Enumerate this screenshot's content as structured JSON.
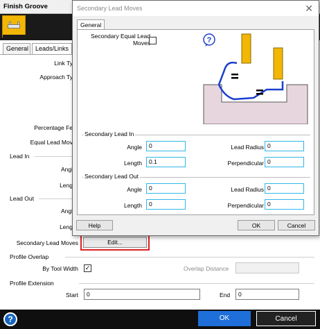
{
  "main": {
    "title": "Finish Groove",
    "tabs": [
      {
        "label": "General"
      },
      {
        "label": "Leads/Links"
      }
    ],
    "labels": {
      "link_type": "Link Ty",
      "approach_type": "Approach Ty",
      "percentage_feed": "Percentage Fe",
      "equal_lead_moves": "Equal Lead Mov",
      "lead_in_angle": "Angl",
      "lead_in_length": "Leng",
      "lead_out_angle": "Angl",
      "lead_out_length": "Leng",
      "secondary_lead_moves": "Secondary Lead Moves",
      "by_tool_width": "By Tool Width",
      "overlap_distance": "Overlap Distance",
      "start": "Start",
      "end": "End"
    },
    "sections": {
      "lead_in": "Lead In",
      "lead_out": "Lead Out",
      "profile_overlap": "Profile Overlap",
      "profile_extension": "Profile Extension"
    },
    "edit_button": "Edit...",
    "by_tool_width_checked": "✓",
    "start_value": "0",
    "end_value": "0",
    "ok_label": "OK",
    "cancel_label": "Cancel",
    "help_icon": "?"
  },
  "dialog": {
    "title": "Secondary Lead Moves",
    "close_icon": "✕",
    "tab": "General",
    "equal_lead_moves_label_1": "Secondary Equal Lead",
    "equal_lead_moves_label_2": "Moves",
    "help_icon": "?",
    "lead_in": {
      "title": "Secondary Lead In",
      "angle_label": "Angle",
      "angle_value": "0",
      "length_label": "Length",
      "length_value": "0.1",
      "lead_radius_label": "Lead Radius",
      "lead_radius_value": "0",
      "perpendicular_label": "Perpendicular",
      "perpendicular_value": "0"
    },
    "lead_out": {
      "title": "Secondary Lead Out",
      "angle_label": "Angle",
      "angle_value": "0",
      "length_label": "Length",
      "length_value": "0",
      "lead_radius_label": "Lead Radius",
      "lead_radius_value": "0",
      "perpendicular_label": "Perpendicular",
      "perpendicular_value": "0"
    },
    "help_button": "Help",
    "ok_button": "OK",
    "cancel_button": "Cancel"
  },
  "colors": {
    "accent_blue": "#1e6fd9",
    "field_border": "#2fb6e8",
    "tool_yellow": "#f2b705",
    "stock_pink": "#e8d6de",
    "path_blue": "#1a3fd0",
    "highlight_red": "#e02020"
  }
}
